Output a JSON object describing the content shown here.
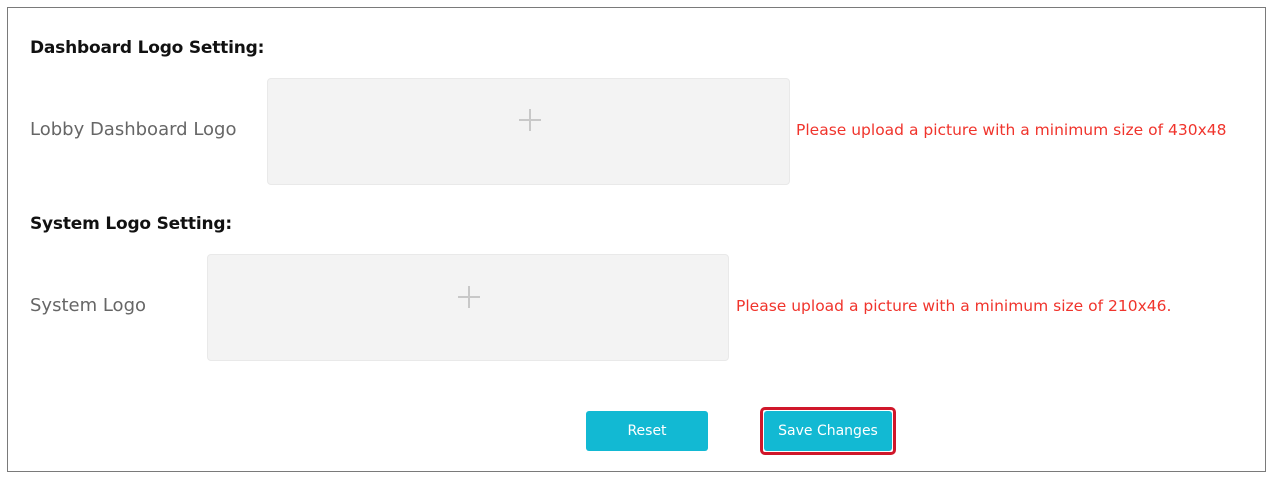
{
  "dashboard_section": {
    "title": "Dashboard Logo Setting:",
    "field_label": "Lobby Dashboard Logo",
    "hint": "Please upload a picture with a minimum size of 430x48"
  },
  "system_section": {
    "title": "System Logo Setting:",
    "field_label": "System Logo",
    "hint": "Please upload a picture with a minimum size of 210x46."
  },
  "actions": {
    "reset_label": "Reset",
    "save_label": "Save Changes"
  },
  "colors": {
    "accent": "#12b9d3",
    "hint_red": "#f0342c",
    "highlight_red": "#d0172a"
  },
  "icons": {
    "upload": "plus-icon"
  }
}
